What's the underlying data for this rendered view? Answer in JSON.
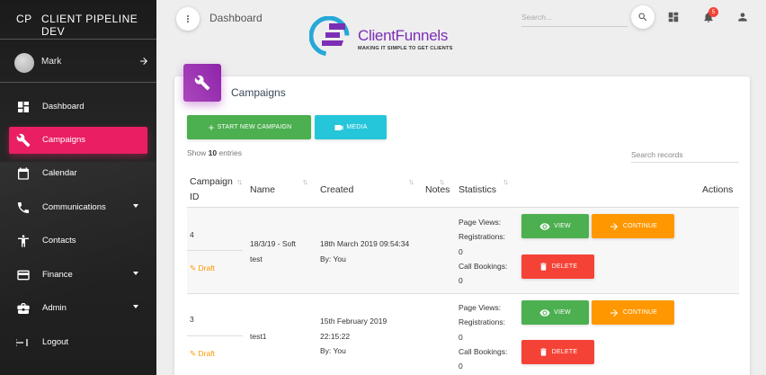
{
  "sidebar": {
    "brand_mini": "CP",
    "brand_full": "CLIENT PIPELINE DEV",
    "user_name": "Mark",
    "items": [
      {
        "label": "Dashboard",
        "icon": "dashboard-icon"
      },
      {
        "label": "Campaigns",
        "icon": "wrench-icon",
        "active": true
      },
      {
        "label": "Calendar",
        "icon": "calendar-icon"
      },
      {
        "label": "Communications",
        "icon": "phone-icon",
        "expandable": true
      },
      {
        "label": "Contacts",
        "icon": "person-icon"
      },
      {
        "label": "Finance",
        "icon": "credit-card-icon",
        "expandable": true
      },
      {
        "label": "Admin",
        "icon": "briefcase-icon",
        "expandable": true
      },
      {
        "label": "Logout",
        "icon": "logout-icon"
      }
    ]
  },
  "topbar": {
    "page_title": "Dashboard",
    "search_placeholder": "Search...",
    "notification_count": "5",
    "logo_word": "ClientFunnels",
    "logo_tagline": "MAKING IT SIMPLE TO GET CLIENTS"
  },
  "card": {
    "title": "Campaigns",
    "start_button": "START NEW CAMPAIGN",
    "media_button": "MEDIA",
    "show_prefix": "Show",
    "show_count": "10",
    "show_suffix": "entries",
    "search_placeholder": "Search records"
  },
  "table": {
    "columns": {
      "id_line1": "Campaign",
      "id_line2": "ID",
      "name": "Name",
      "created": "Created",
      "notes": "Notes",
      "statistics": "Statistics",
      "actions": "Actions"
    },
    "rows": [
      {
        "id": "4",
        "status": "Draft",
        "name_line1": "18/3/19 - Soft",
        "name_line2": "test",
        "created_line1": "18th March 2019 09:54:34",
        "created_line2": "By: You",
        "page_views_label": "Page Views:",
        "registrations_label": "Registrations:",
        "registrations_value": "0",
        "call_bookings_label": "Call Bookings:",
        "call_bookings_value": "0",
        "view_label": "VIEW",
        "continue_label": "CONTINUE",
        "delete_label": "DELETE"
      },
      {
        "id": "3",
        "status": "Draft",
        "name_line1": "test1",
        "created_line1": "15th February 2019",
        "created_line2": "22:15:22",
        "created_line3": "By: You",
        "page_views_label": "Page Views:",
        "registrations_label": "Registrations:",
        "registrations_value": "0",
        "call_bookings_label": "Call Bookings:",
        "call_bookings_value": "0",
        "view_label": "VIEW",
        "continue_label": "CONTINUE",
        "delete_label": "DELETE"
      }
    ]
  },
  "colors": {
    "accent_pink": "#e91e63",
    "purple": "#9c27b0",
    "green": "#4caf50",
    "cyan": "#26c6da",
    "orange": "#ff9800",
    "red": "#f44336"
  }
}
